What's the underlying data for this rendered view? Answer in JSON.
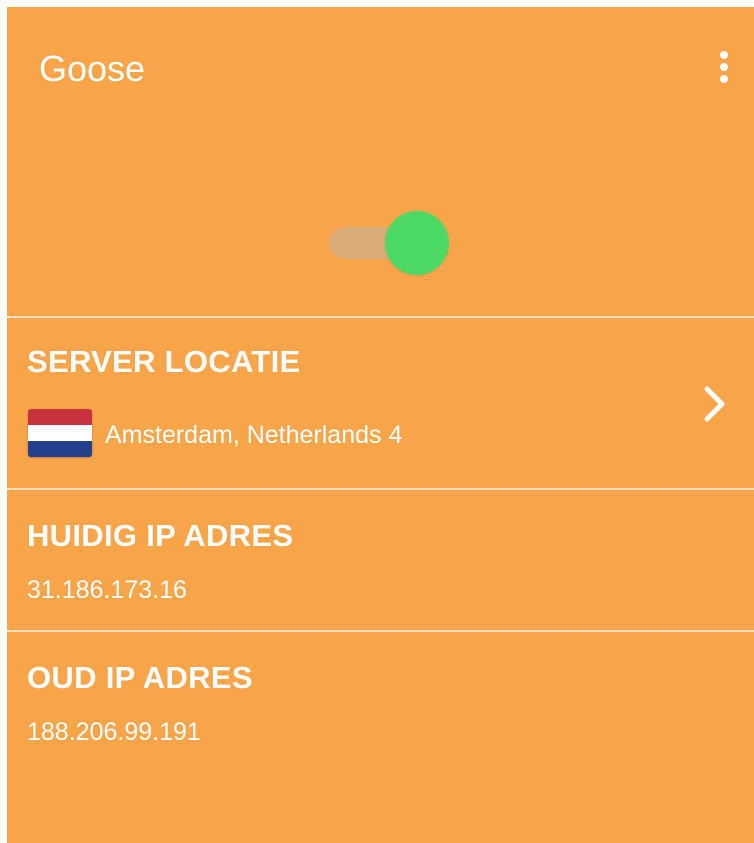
{
  "app": {
    "title": "Goose",
    "background_color": "#f8a54a",
    "menu_icon": "more-vertical-icon"
  },
  "vpn_toggle": {
    "state": "on",
    "knob_color": "#4cd964",
    "track_color": "#d9ab78"
  },
  "server_location": {
    "title": "SERVER LOCATIE",
    "location": "Amsterdam, Netherlands 4",
    "flag_icon": "netherlands-flag-icon",
    "flag_colors": [
      "#c8323c",
      "#ffffff",
      "#22408c"
    ],
    "action_icon": "chevron-right-icon"
  },
  "current_ip": {
    "title": "HUIDIG IP ADRES",
    "value": "31.186.173.16"
  },
  "old_ip": {
    "title": "OUD IP ADRES",
    "value": "188.206.99.191"
  }
}
